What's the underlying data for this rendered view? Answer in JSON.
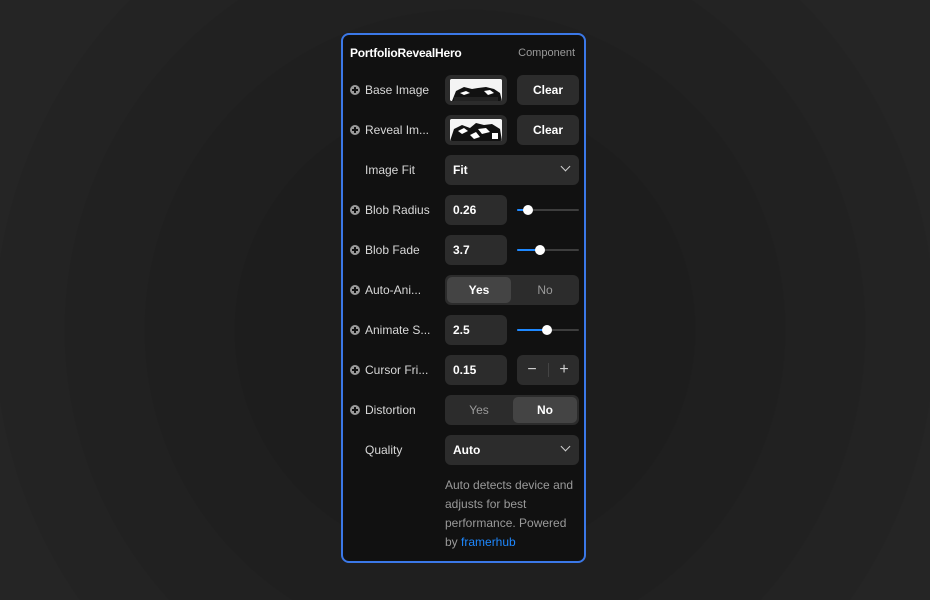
{
  "panel": {
    "title": "PortfolioRevealHero",
    "subtitle": "Component"
  },
  "rows": {
    "base_image": {
      "label": "Base Image",
      "button": "Clear"
    },
    "reveal_image": {
      "label": "Reveal Im...",
      "button": "Clear"
    },
    "image_fit": {
      "label": "Image Fit",
      "value": "Fit"
    },
    "blob_radius": {
      "label": "Blob Radius",
      "value": "0.26",
      "slider_fraction": 0.18
    },
    "blob_fade": {
      "label": "Blob Fade",
      "value": "3.7",
      "slider_fraction": 0.37
    },
    "auto_animate": {
      "label": "Auto-Ani...",
      "options": [
        "Yes",
        "No"
      ],
      "selected": "Yes"
    },
    "animate_speed": {
      "label": "Animate S...",
      "value": "2.5",
      "slider_fraction": 0.48
    },
    "cursor_friction": {
      "label": "Cursor Fri...",
      "value": "0.15",
      "minus": "−",
      "plus": "+"
    },
    "distortion": {
      "label": "Distortion",
      "options": [
        "Yes",
        "No"
      ],
      "selected": "No"
    },
    "quality": {
      "label": "Quality",
      "value": "Auto"
    }
  },
  "description": {
    "text": "Auto detects device and adjusts for best performance. Powered by ",
    "link": "framerhub"
  },
  "colors": {
    "accent": "#1e88ff",
    "border": "#3b78e7",
    "panel_bg": "#111111",
    "control_bg": "#2c2c2c"
  },
  "icons": {
    "add_property": "plus-circle-icon",
    "dropdown": "chevron-down-icon"
  }
}
